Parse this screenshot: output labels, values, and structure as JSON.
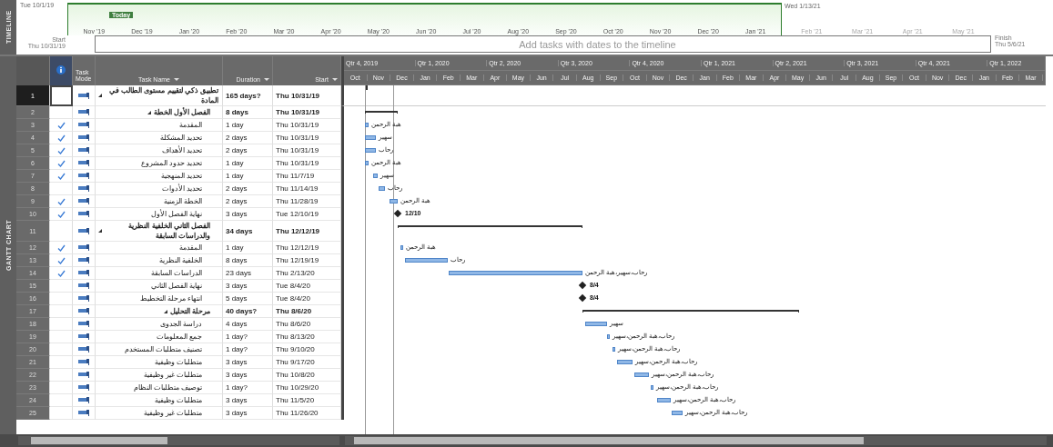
{
  "views": {
    "timeline": "TIMELINE",
    "gantt": "GANTT CHART"
  },
  "timeline": {
    "range_start": "Tue 10/1/19",
    "range_end": "Wed 1/13/21",
    "today": "Today",
    "start_label": "Start",
    "start": "Thu 10/31/19",
    "finish_label": "Finish",
    "finish": "Thu 5/6/21",
    "hint": "Add tasks with dates to the timeline",
    "ticks": [
      {
        "label": "Nov '19",
        "in_view": true
      },
      {
        "label": "Dec '19",
        "in_view": true
      },
      {
        "label": "Jan '20",
        "in_view": true
      },
      {
        "label": "Feb '20",
        "in_view": true
      },
      {
        "label": "Mar '20",
        "in_view": true
      },
      {
        "label": "Apr '20",
        "in_view": true
      },
      {
        "label": "May '20",
        "in_view": true
      },
      {
        "label": "Jun '20",
        "in_view": true
      },
      {
        "label": "Jul '20",
        "in_view": true
      },
      {
        "label": "Aug '20",
        "in_view": true
      },
      {
        "label": "Sep '20",
        "in_view": true
      },
      {
        "label": "Oct '20",
        "in_view": true
      },
      {
        "label": "Nov '20",
        "in_view": true
      },
      {
        "label": "Dec '20",
        "in_view": true
      },
      {
        "label": "Jan '21",
        "in_view": true
      },
      {
        "label": "Feb '21",
        "in_view": false
      },
      {
        "label": "Mar '21",
        "in_view": false
      },
      {
        "label": "Apr '21",
        "in_view": false
      },
      {
        "label": "May '21",
        "in_view": false
      }
    ]
  },
  "columns": [
    {
      "kind": "indicators"
    },
    {
      "kind": "mode",
      "label": "Task Mode"
    },
    {
      "kind": "name",
      "label": "Task Name"
    },
    {
      "kind": "duration",
      "label": "Duration"
    },
    {
      "kind": "start",
      "label": "Start"
    }
  ],
  "timescale": {
    "quarters": [
      "Qtr 4, 2019",
      "Qtr 1, 2020",
      "Qtr 2, 2020",
      "Qtr 3, 2020",
      "Qtr 4, 2020",
      "Qtr 1, 2021",
      "Qtr 2, 2021",
      "Qtr 3, 2021",
      "Qtr 4, 2021",
      "Qtr 1, 2022"
    ],
    "months": [
      "Oct",
      "Nov",
      "Dec",
      "Jan",
      "Feb",
      "Mar",
      "Apr",
      "May",
      "Jun",
      "Jul",
      "Aug",
      "Sep",
      "Oct",
      "Nov",
      "Dec",
      "Jan",
      "Feb",
      "Mar",
      "Apr",
      "May",
      "Jun",
      "Jul",
      "Aug",
      "Sep",
      "Oct",
      "Nov",
      "Dec",
      "Jan",
      "Feb",
      "Mar"
    ]
  },
  "tasks": [
    {
      "id": "1",
      "selected": true,
      "complete": false,
      "summary": true,
      "expanded": true,
      "name": "تطبيق ذكي لتقييم مستوى الطالب في المادة",
      "duration": "165 days?",
      "start": "Thu 10/31/19",
      "bar": {
        "kind": "marker"
      },
      "children": [
        {
          "id": "2",
          "selected": false,
          "complete": false,
          "summary": true,
          "expanded": true,
          "name": "الفصل الأول الخطة",
          "duration": "8 days",
          "start": "Thu 10/31/19",
          "bar": {
            "kind": "summary"
          },
          "children": [
            {
              "id": "3",
              "selected": false,
              "complete": true,
              "summary": false,
              "name": "المقدمة",
              "duration": "1 day",
              "start": "Thu 10/31/19",
              "bar": {
                "kind": "task",
                "label": "هبة الرحمن"
              }
            },
            {
              "id": "4",
              "selected": false,
              "complete": true,
              "summary": false,
              "name": "تحديد المشكلة",
              "duration": "2 days",
              "start": "Thu 10/31/19",
              "bar": {
                "kind": "task",
                "label": "سهير"
              }
            },
            {
              "id": "5",
              "selected": false,
              "complete": true,
              "summary": false,
              "name": "تحديد الأهداف",
              "duration": "2 days",
              "start": "Thu 10/31/19",
              "bar": {
                "kind": "task",
                "label": "رحاب"
              }
            },
            {
              "id": "6",
              "selected": false,
              "complete": true,
              "summary": false,
              "name": "تحديد حدود المشروع",
              "duration": "1 day",
              "start": "Thu 10/31/19",
              "bar": {
                "kind": "task",
                "label": "هبة الرحمن"
              }
            },
            {
              "id": "7",
              "selected": false,
              "complete": true,
              "summary": false,
              "name": "تحديد المنهجية",
              "duration": "1 day",
              "start": "Thu 11/7/19",
              "bar": {
                "kind": "task",
                "label": "سهير"
              }
            },
            {
              "id": "8",
              "selected": false,
              "complete": false,
              "summary": false,
              "name": "تحديد الأدوات",
              "duration": "2 days",
              "start": "Thu 11/14/19",
              "bar": {
                "kind": "task",
                "label": "رحاب"
              }
            },
            {
              "id": "9",
              "selected": false,
              "complete": true,
              "summary": false,
              "name": "الخطة الزمنية",
              "duration": "2 days",
              "start": "Thu 11/28/19",
              "bar": {
                "kind": "task",
                "label": "هبة الرحمن"
              }
            },
            {
              "id": "10",
              "selected": false,
              "complete": true,
              "summary": false,
              "name": "نهاية الفصل الأول",
              "duration": "3 days",
              "start": "Tue 12/10/19",
              "bar": {
                "kind": "milestone",
                "label": "12/10"
              }
            }
          ]
        },
        {
          "id": "11",
          "selected": false,
          "complete": false,
          "summary": true,
          "expanded": true,
          "name": "الفصل الثاني الخلفية النظرية والدراسات السابقة",
          "duration": "34 days",
          "start": "Thu 12/12/19",
          "bar": {
            "kind": "summary"
          },
          "children": [
            {
              "id": "12",
              "selected": false,
              "complete": true,
              "summary": false,
              "name": "المقدمة",
              "duration": "1 day",
              "start": "Thu 12/12/19",
              "bar": {
                "kind": "task",
                "label": "هبة الرحمن"
              }
            },
            {
              "id": "13",
              "selected": false,
              "complete": true,
              "summary": false,
              "name": "الخلفية النظرية",
              "duration": "8 days",
              "start": "Thu 12/19/19",
              "bar": {
                "kind": "task",
                "label": "رحاب"
              }
            },
            {
              "id": "14",
              "selected": false,
              "complete": true,
              "summary": false,
              "name": "الدراسات السابقة",
              "duration": "23 days",
              "start": "Thu 2/13/20",
              "bar": {
                "kind": "task",
                "label": "رحاب،سهير،هبة الرحمن"
              }
            },
            {
              "id": "15",
              "selected": false,
              "complete": false,
              "summary": false,
              "name": "نهاية الفصل الثاني",
              "duration": "3 days",
              "start": "Tue 8/4/20",
              "bar": {
                "kind": "milestone",
                "label": "8/4"
              }
            },
            {
              "id": "16",
              "selected": false,
              "complete": false,
              "summary": false,
              "name": "انتهاء مرحلة التخطيط",
              "duration": "5 days",
              "start": "Tue 8/4/20",
              "bar": {
                "kind": "milestone",
                "label": "8/4"
              }
            }
          ]
        },
        {
          "id": "17",
          "selected": false,
          "complete": false,
          "summary": true,
          "expanded": true,
          "name": "مرحلة التحليل",
          "duration": "40 days?",
          "start": "Thu 8/6/20",
          "bar": {
            "kind": "summary"
          },
          "children": [
            {
              "id": "18",
              "selected": false,
              "complete": false,
              "summary": false,
              "name": "دراسة الجدوى",
              "duration": "4 days",
              "start": "Thu 8/6/20",
              "bar": {
                "kind": "task",
                "label": "سهير"
              }
            },
            {
              "id": "19",
              "selected": false,
              "complete": false,
              "summary": false,
              "name": "جمع المعلومات",
              "duration": "1 day?",
              "start": "Thu 8/13/20",
              "bar": {
                "kind": "task",
                "label": "رحاب،هبة الرحمن،سهير"
              }
            },
            {
              "id": "20",
              "selected": false,
              "complete": false,
              "summary": false,
              "name": "تصنيف متطلبات المستخدم",
              "duration": "1 day?",
              "start": "Thu 9/10/20",
              "bar": {
                "kind": "task",
                "label": "رحاب،هبة الرحمن،سهير"
              }
            },
            {
              "id": "21",
              "selected": false,
              "complete": false,
              "summary": false,
              "name": "متطلبات وظيفية",
              "duration": "3 days",
              "start": "Thu 9/17/20",
              "bar": {
                "kind": "task",
                "label": "رحاب،هبة الرحمن،سهير"
              }
            },
            {
              "id": "22",
              "selected": false,
              "complete": false,
              "summary": false,
              "name": "متطلبات غير وظيفية",
              "duration": "3 days",
              "start": "Thu 10/8/20",
              "bar": {
                "kind": "task",
                "label": "رحاب،هبة الرحمن،سهير"
              }
            },
            {
              "id": "23",
              "selected": false,
              "complete": false,
              "summary": false,
              "name": "توصيف متطلبات النظام",
              "duration": "1 day?",
              "start": "Thu 10/29/20",
              "bar": {
                "kind": "task",
                "label": "رحاب،هبة الرحمن،سهير"
              }
            },
            {
              "id": "24",
              "selected": false,
              "complete": false,
              "summary": false,
              "name": "متطلبات وظيفية",
              "duration": "3 days",
              "start": "Thu 11/5/20",
              "bar": {
                "kind": "task",
                "label": "رحاب،هبة الرحمن،سهير"
              }
            },
            {
              "id": "25",
              "selected": false,
              "complete": false,
              "summary": false,
              "name": "متطلبات غير وظيفية",
              "duration": "3 days",
              "start": "Thu 11/26/20",
              "bar": {
                "kind": "task",
                "label": "رحاب،هبة الرحمن،سهير"
              }
            }
          ]
        }
      ]
    }
  ]
}
